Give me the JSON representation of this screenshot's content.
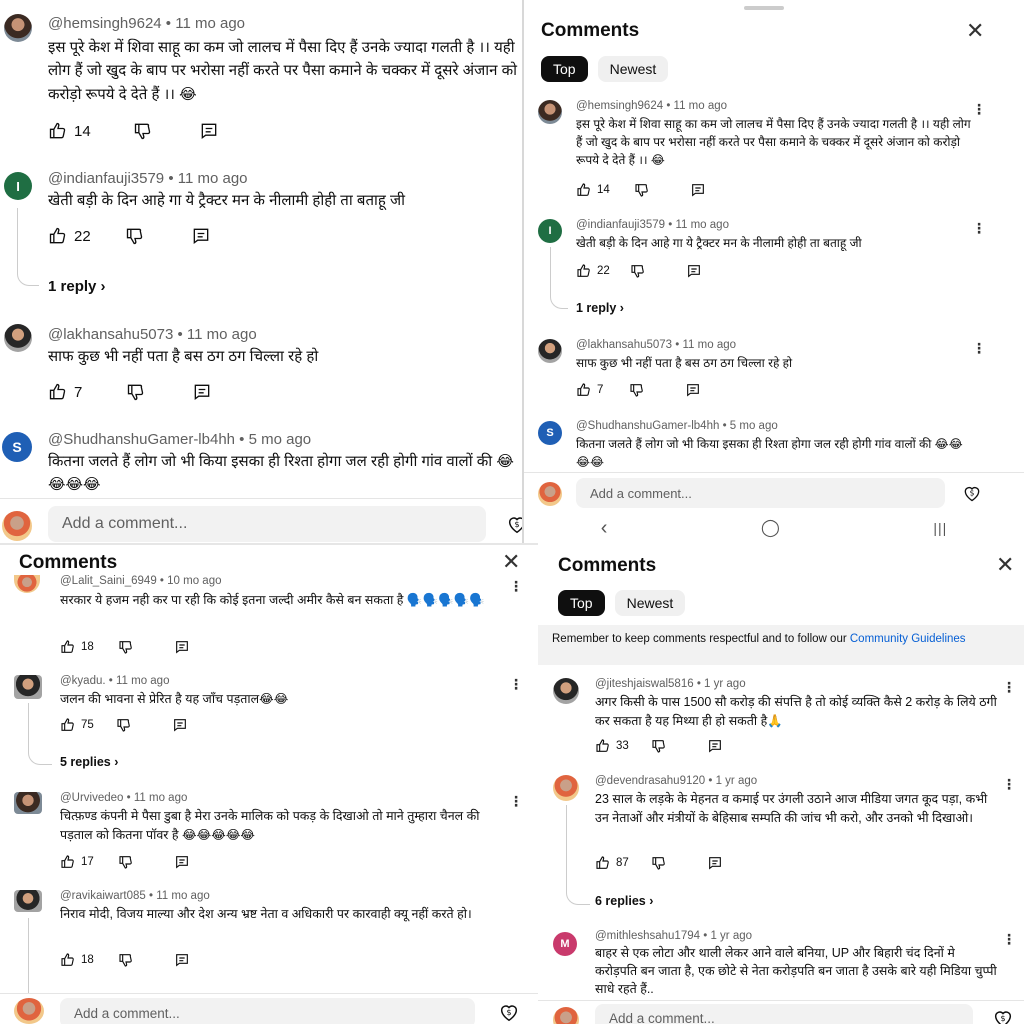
{
  "p1": {
    "comments": [
      {
        "author": "@hemsingh9624",
        "time": "11 mo ago",
        "text": "इस पूरे केश में शिवा साहू का कम जो लालच में पैसा दिए हैं उनके ज्यादा गलती है ।। यही लोग हैं जो खुद के बाप पर भरोसा नहीं करते पर पैसा कमाने के चक्कर में दूसरे अंजान को करोड़ो रूपये दे देते हैं ।। 😂",
        "likes": "14"
      },
      {
        "author": "@indianfauji3579",
        "time": "11 mo ago",
        "text": "खेती बड़ी के दिन आहे गा ये ट्रैक्टर मन के नीलामी होही ता बताहू जी",
        "likes": "22",
        "replies": "1 reply",
        "avatar_letter": "I"
      },
      {
        "author": "@lakhansahu5073",
        "time": "11 mo ago",
        "text": "साफ कुछ भी नहीं पता है बस ठग ठग चिल्ला रहे हो",
        "likes": "7"
      },
      {
        "author": "@ShudhanshuGamer-lb4hh",
        "time": "5 mo ago",
        "text": "कितना जलते हैं लोग जो भी किया इसका ही रिश्ता होगा जल रही होगी गांव वालों की 😂😂😂😂",
        "avatar_letter": "S"
      }
    ],
    "add_comment": "Add a comment..."
  },
  "p2": {
    "title": "Comments",
    "tabs": [
      "Top",
      "Newest"
    ],
    "comments": [
      {
        "author": "@hemsingh9624",
        "time": "11 mo ago",
        "text": "इस पूरे केश में शिवा साहू का कम जो लालच में पैसा दिए हैं उनके ज्यादा गलती है ।। यही लोग हैं जो खुद के बाप पर भरोसा नहीं करते पर पैसा कमाने के चक्कर में दूसरे अंजान को करोड़ो रूपये दे देते हैं ।। 😂",
        "likes": "14"
      },
      {
        "author": "@indianfauji3579",
        "time": "11 mo ago",
        "text": "खेती बड़ी के दिन आहे गा ये ट्रैक्टर मन के नीलामी होही ता बताहू जी",
        "likes": "22",
        "replies": "1 reply",
        "avatar_letter": "I"
      },
      {
        "author": "@lakhansahu5073",
        "time": "11 mo ago",
        "text": "साफ कुछ भी नहीं पता है बस ठग ठग चिल्ला रहे हो",
        "likes": "7"
      },
      {
        "author": "@ShudhanshuGamer-lb4hh",
        "time": "5 mo ago",
        "text": "कितना जलते हैं लोग जो भी किया इसका ही रिश्ता होगा जल रही होगी गांव वालों की 😂😂😂😂",
        "avatar_letter": "S"
      }
    ],
    "add_comment": "Add a comment..."
  },
  "p3": {
    "title": "Comments",
    "comments": [
      {
        "author": "@Lalit_Saini_6949",
        "time": "10 mo ago",
        "text": "सरकार ये हजम नही कर पा रही कि कोई इतना जल्दी अमीर कैसे बन सकता है 🗣️🗣️🗣️🗣️🗣️",
        "likes": "18"
      },
      {
        "author": "@kyadu.",
        "time": "11 mo ago",
        "text": "जलन की भावना से प्रेरित है यह जाँच पड़ताल😂😂",
        "likes": "75",
        "replies": "5 replies"
      },
      {
        "author": "@Urvivedeo",
        "time": "11 mo ago",
        "text": "चित्फ़ण्ड कंपनी मे पैसा डुबा है मेरा उनके मालिक को पकड़ के दिखाओ तो माने तुम्हारा चैनल की पड़ताल को कितना पॉवर है 😂😂😂😂😂",
        "likes": "17"
      },
      {
        "author": "@ravikaiwart085",
        "time": "11 mo ago",
        "text": "निराव मोदी, विजय माल्या और देश अन्य भ्रष्ट नेता व अधिकारी पर कारवाही क्यू नहीं करते हो।",
        "likes": "18"
      }
    ],
    "add_comment": "Add a comment..."
  },
  "p4": {
    "title": "Comments",
    "tabs": [
      "Top",
      "Newest"
    ],
    "notice": "Remember to keep comments respectful and to follow our",
    "notice_link": "Community Guidelines",
    "comments": [
      {
        "author": "@jiteshjaiswal5816",
        "time": "1 yr ago",
        "text": "अगर किसी के पास 1500 सौ करोड़ की संपत्ति है तो कोई व्यक्ति कैसे 2 करोड़ के लिये ठगी कर सकता है यह मिथ्या ही हो सकती है🙏",
        "likes": "33"
      },
      {
        "author": "@devendrasahu9120",
        "time": "1 yr ago",
        "text": "23 साल के लड़के के मेहनत व कमाई पर उंगली उठाने आज मीडिया जगत कूद पड़ा, कभी उन नेताओं और मंत्रीयों के बेहिसाब सम्पति की जांच भी करो, और उनको भी दिखाओ।",
        "likes": "87",
        "replies": "6 replies"
      },
      {
        "author": "@mithleshsahu1794",
        "time": "1 yr ago",
        "text": "बाहर से एक लोटा और थाली लेकर आने वाले बनिया, UP और बिहारी चंद दिनों मे करोड़पति बन जाता है, एक छोटे से नेता करोड़पति बन जाता है उसके बारे यही मिडिया चुप्पी साधे रहते हैं..",
        "avatar_letter": "M"
      }
    ],
    "add_comment": "Add a comment..."
  }
}
